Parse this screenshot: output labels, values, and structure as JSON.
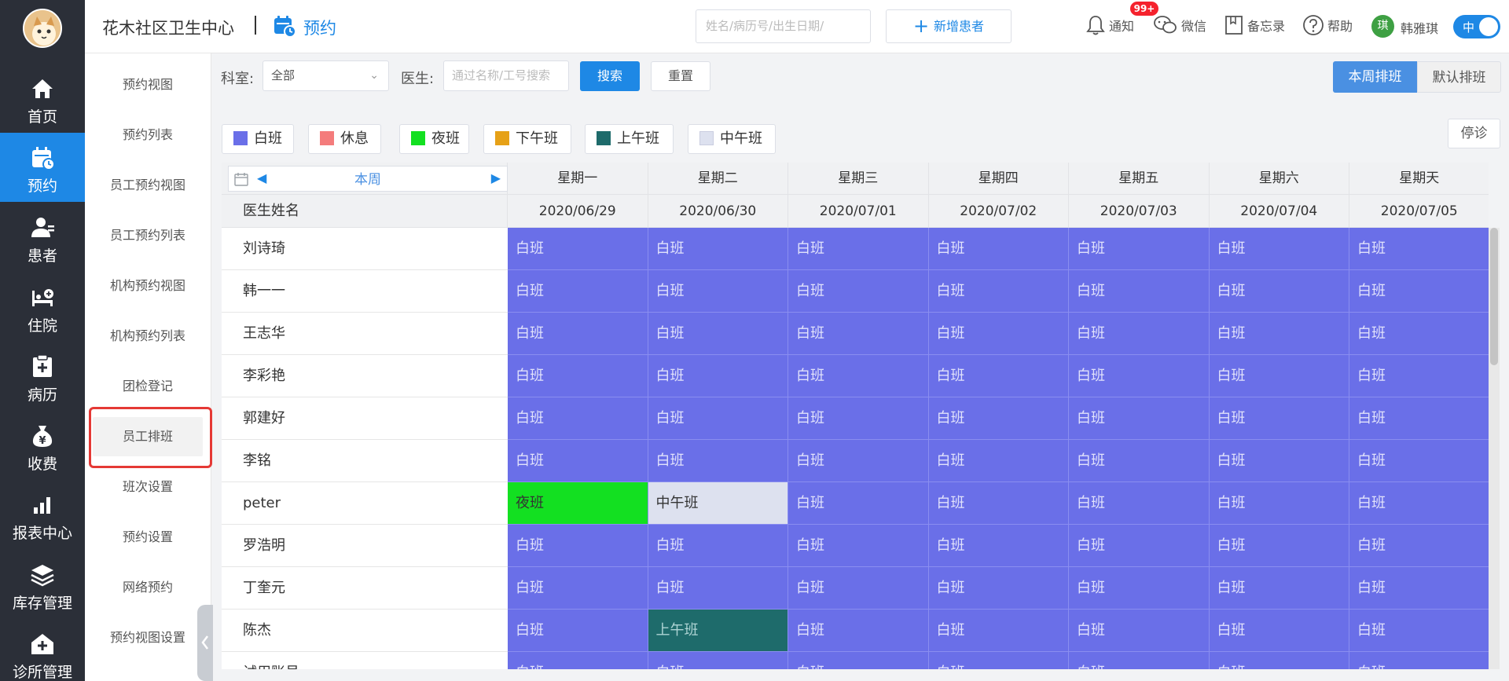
{
  "nav": {
    "items": [
      {
        "key": "home",
        "label": "首页",
        "icon": "home-icon"
      },
      {
        "key": "appointment",
        "label": "预约",
        "icon": "calendar-icon",
        "active": true
      },
      {
        "key": "patient",
        "label": "患者",
        "icon": "patient-icon"
      },
      {
        "key": "inpatient",
        "label": "住院",
        "icon": "bed-icon"
      },
      {
        "key": "records",
        "label": "病历",
        "icon": "medical-record-icon"
      },
      {
        "key": "billing",
        "label": "收费",
        "icon": "money-bag-icon"
      },
      {
        "key": "reports",
        "label": "报表中心",
        "icon": "bar-chart-icon"
      },
      {
        "key": "inventory",
        "label": "库存管理",
        "icon": "layers-icon"
      },
      {
        "key": "clinic",
        "label": "诊所管理",
        "icon": "clinic-icon"
      }
    ]
  },
  "submenu": {
    "items": [
      {
        "label": "预约视图"
      },
      {
        "label": "预约列表"
      },
      {
        "label": "员工预约视图"
      },
      {
        "label": "员工预约列表"
      },
      {
        "label": "机构预约视图"
      },
      {
        "label": "机构预约列表"
      },
      {
        "label": "团检登记"
      },
      {
        "label": "员工排班",
        "active": true
      },
      {
        "label": "班次设置"
      },
      {
        "label": "预约设置"
      },
      {
        "label": "网络预约"
      },
      {
        "label": "预约视图设置"
      }
    ]
  },
  "header": {
    "org_title": "花木社区卫生中心",
    "section": "预约",
    "search_placeholder": "姓名/病历号/出生日期/",
    "new_patient": "新增患者",
    "notify": "通知",
    "notify_badge": "99+",
    "wechat": "微信",
    "memo": "备忘录",
    "help": "帮助",
    "user_initial": "琪",
    "user_name": "韩雅琪",
    "lang": "中"
  },
  "filters": {
    "dept_label": "科室:",
    "dept_value": "全部",
    "doctor_label": "医生:",
    "doctor_placeholder": "通过名称/工号搜索",
    "search_btn": "搜索",
    "reset_btn": "重置",
    "this_week_btn": "本周排班",
    "default_btn": "默认排班"
  },
  "legend": [
    {
      "label": "白班",
      "color": "#6a6fe8"
    },
    {
      "label": "休息",
      "color": "#f47c7c"
    },
    {
      "label": "夜班",
      "color": "#13e021"
    },
    {
      "label": "下午班",
      "color": "#e6a117"
    },
    {
      "label": "上午班",
      "color": "#1e6b6b"
    },
    {
      "label": "中午班",
      "color": "#dde1ef"
    }
  ],
  "stop_btn": "停诊",
  "schedule": {
    "week_label": "本周",
    "name_header": "医生姓名",
    "days": [
      {
        "weekday": "星期一",
        "date": "2020/06/29"
      },
      {
        "weekday": "星期二",
        "date": "2020/06/30"
      },
      {
        "weekday": "星期三",
        "date": "2020/07/01"
      },
      {
        "weekday": "星期四",
        "date": "2020/07/02"
      },
      {
        "weekday": "星期五",
        "date": "2020/07/03"
      },
      {
        "weekday": "星期六",
        "date": "2020/07/04"
      },
      {
        "weekday": "星期天",
        "date": "2020/07/05"
      }
    ],
    "shift_colors": {
      "白班": "#6a6fe8",
      "夜班": "#13e021",
      "中午班": "#dde1ef",
      "上午班": "#1e6b6b"
    },
    "rows": [
      {
        "name": "刘诗琦",
        "shifts": [
          "白班",
          "白班",
          "白班",
          "白班",
          "白班",
          "白班",
          "白班"
        ]
      },
      {
        "name": "韩一一",
        "shifts": [
          "白班",
          "白班",
          "白班",
          "白班",
          "白班",
          "白班",
          "白班"
        ]
      },
      {
        "name": "王志华",
        "shifts": [
          "白班",
          "白班",
          "白班",
          "白班",
          "白班",
          "白班",
          "白班"
        ]
      },
      {
        "name": "李彩艳",
        "shifts": [
          "白班",
          "白班",
          "白班",
          "白班",
          "白班",
          "白班",
          "白班"
        ]
      },
      {
        "name": "郭建好",
        "shifts": [
          "白班",
          "白班",
          "白班",
          "白班",
          "白班",
          "白班",
          "白班"
        ]
      },
      {
        "name": "李铭",
        "shifts": [
          "白班",
          "白班",
          "白班",
          "白班",
          "白班",
          "白班",
          "白班"
        ]
      },
      {
        "name": "peter",
        "shifts": [
          "夜班",
          "中午班",
          "白班",
          "白班",
          "白班",
          "白班",
          "白班"
        ]
      },
      {
        "name": "罗浩明",
        "shifts": [
          "白班",
          "白班",
          "白班",
          "白班",
          "白班",
          "白班",
          "白班"
        ]
      },
      {
        "name": "丁奎元",
        "shifts": [
          "白班",
          "白班",
          "白班",
          "白班",
          "白班",
          "白班",
          "白班"
        ]
      },
      {
        "name": "陈杰",
        "shifts": [
          "白班",
          "上午班",
          "白班",
          "白班",
          "白班",
          "白班",
          "白班"
        ]
      },
      {
        "name": "试用账号",
        "shifts": [
          "白班",
          "白班",
          "白班",
          "白班",
          "白班",
          "白班",
          "白班"
        ]
      }
    ]
  }
}
